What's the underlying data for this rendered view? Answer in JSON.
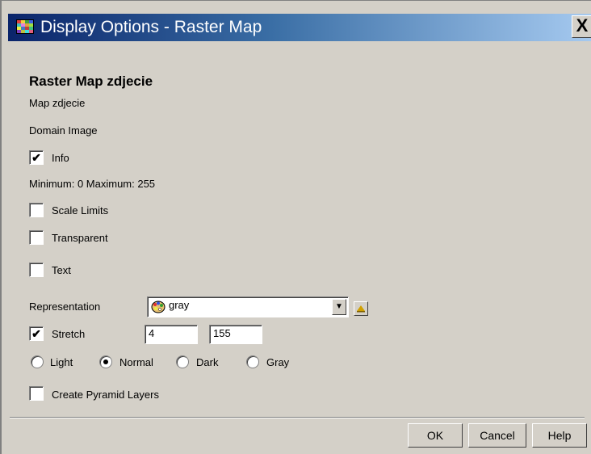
{
  "window": {
    "title": "Display Options - Raster Map",
    "close_label": "X"
  },
  "header": {
    "title": "Raster Map  zdjecie",
    "map_label": "Map zdjecie",
    "domain_label": "Domain Image"
  },
  "options": {
    "info": {
      "label": "Info",
      "checked": true
    },
    "min_max": "Minimum: 0  Maximum: 255",
    "scale_limits": {
      "label": "Scale Limits",
      "checked": false
    },
    "transparent": {
      "label": "Transparent",
      "checked": false
    },
    "text": {
      "label": "Text",
      "checked": false
    }
  },
  "representation": {
    "label": "Representation",
    "value": "gray"
  },
  "stretch": {
    "label": "Stretch",
    "checked": true,
    "min": "4",
    "max": "155"
  },
  "shading": {
    "options": [
      "Light",
      "Normal",
      "Dark",
      "Gray"
    ],
    "selected": "Normal"
  },
  "pyramid": {
    "label": "Create Pyramid Layers",
    "checked": false
  },
  "buttons": {
    "ok": "OK",
    "cancel": "Cancel",
    "help": "Help"
  },
  "icons": {
    "title": "map-window-icon",
    "representation": "palette-icon",
    "combo_arrow": "chevron-down-icon",
    "edit": "edit-representation-icon"
  },
  "colors": {
    "title_gradient_start": "#0a246a",
    "title_gradient_end": "#a6caf0",
    "face": "#d4d0c8"
  }
}
